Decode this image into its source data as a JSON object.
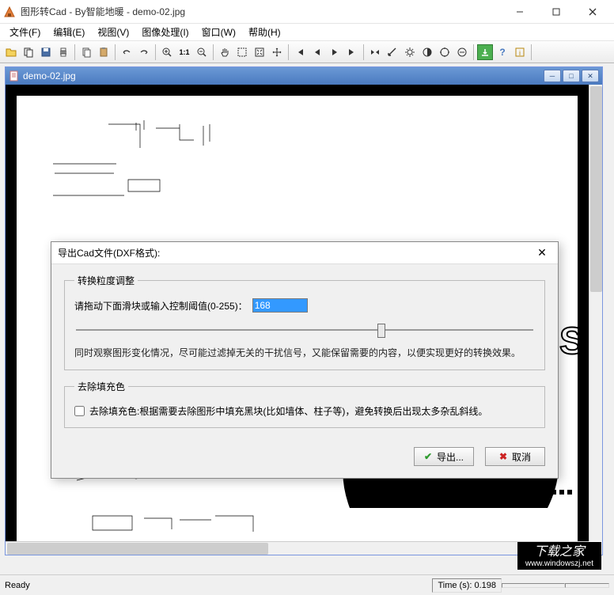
{
  "titlebar": {
    "title": "图形转Cad - By智能地暖 - demo-02.jpg"
  },
  "menu": {
    "file": "文件(F)",
    "edit": "编辑(E)",
    "view": "视图(V)",
    "image": "图像处理(I)",
    "window": "窗口(W)",
    "help": "帮助(H)"
  },
  "mdi": {
    "title": "demo-02.jpg"
  },
  "dialog": {
    "title": "导出Cad文件(DXF格式):",
    "group1_legend": "转换粒度调整",
    "threshold_label": "请拖动下面滑块或输入控制阈值(0-255)：",
    "threshold_value": "168",
    "description": "同时观察图形变化情况，尽可能过滤掉无关的干扰信号，又能保留需要的内容，以便实现更好的转换效果。",
    "group2_legend": "去除填充色",
    "checkbox_label": "去除填充色:根据需要去除图形中填充黑块(比如墙体、柱子等)，避免转换后出现太多杂乱斜线。",
    "export_btn": "导出...",
    "cancel_btn": "取消"
  },
  "status": {
    "ready": "Ready",
    "time": "Time (s): 0.198"
  },
  "watermark": {
    "line1": "下载之家",
    "line2": "www.windowszj.net"
  }
}
